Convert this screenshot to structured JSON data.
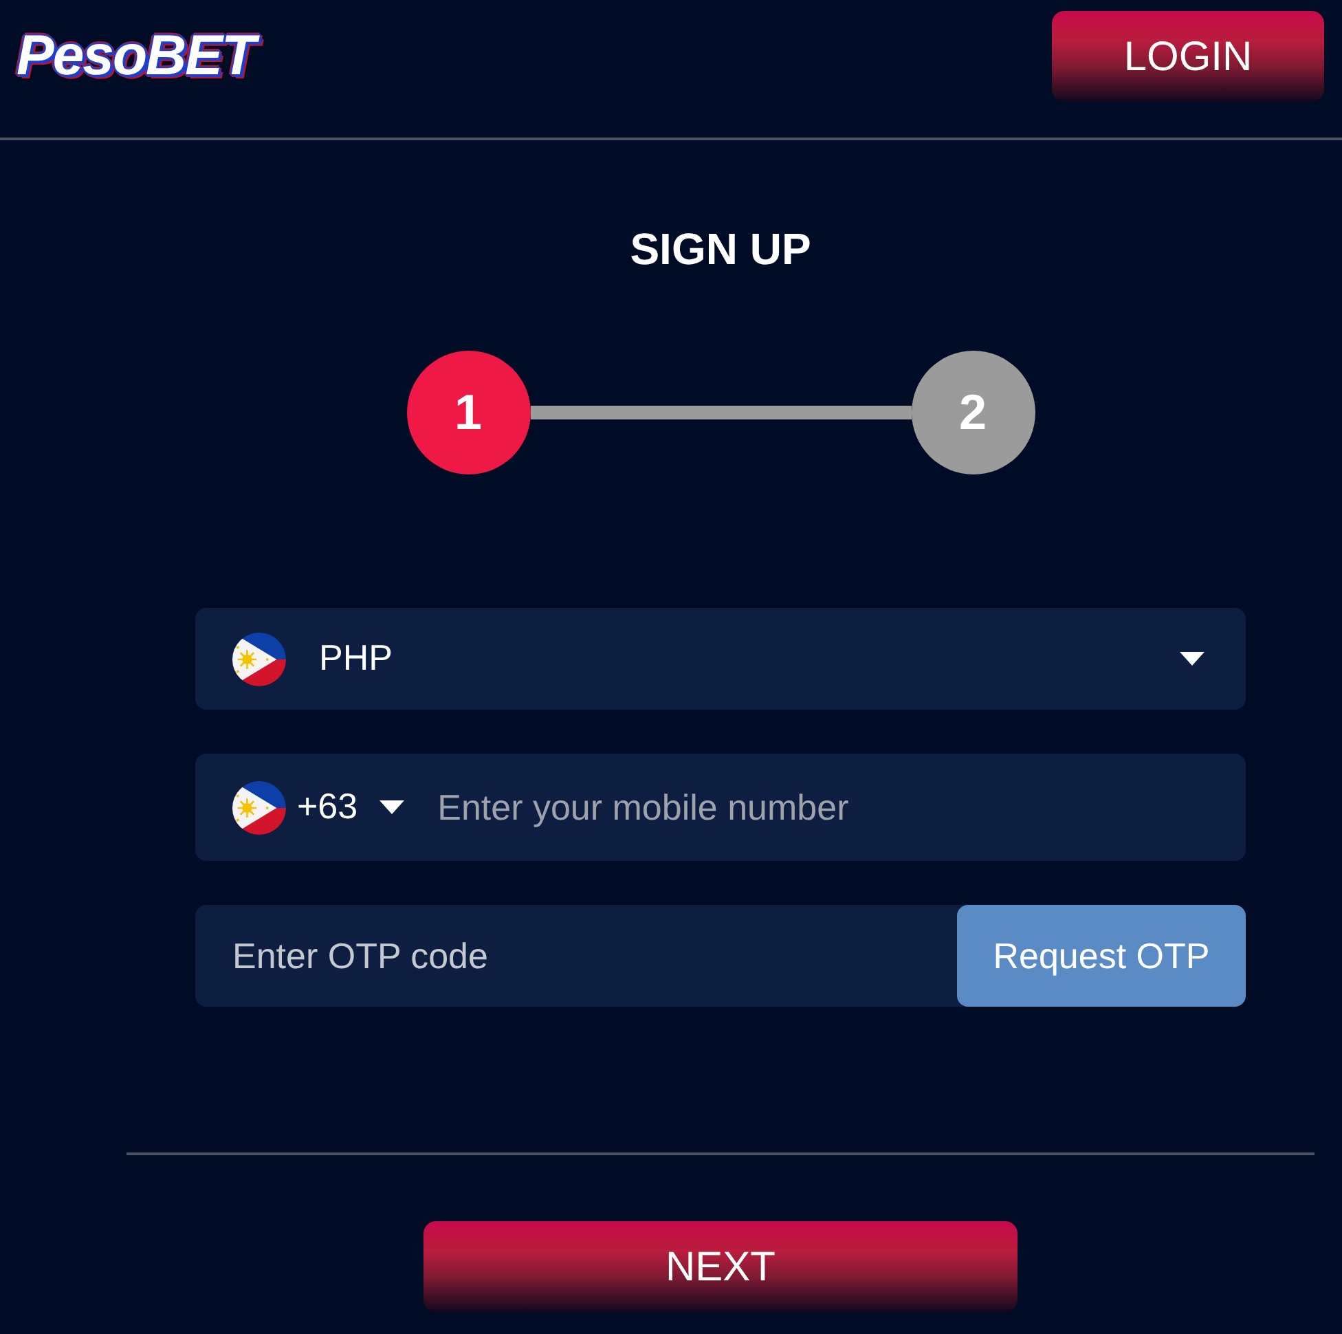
{
  "header": {
    "logo": "PesoBET",
    "login_button": "LOGIN"
  },
  "title": "SIGN UP",
  "steps": [
    {
      "label": "1",
      "selected": true
    },
    {
      "label": "2",
      "selected": false
    }
  ],
  "currency_select": {
    "value": "PHP"
  },
  "phone_field": {
    "country_code": "+63",
    "placeholder": "Enter your mobile number"
  },
  "otp_field": {
    "placeholder": "Enter OTP code",
    "button": "Request OTP"
  },
  "next_button": "NEXT"
}
